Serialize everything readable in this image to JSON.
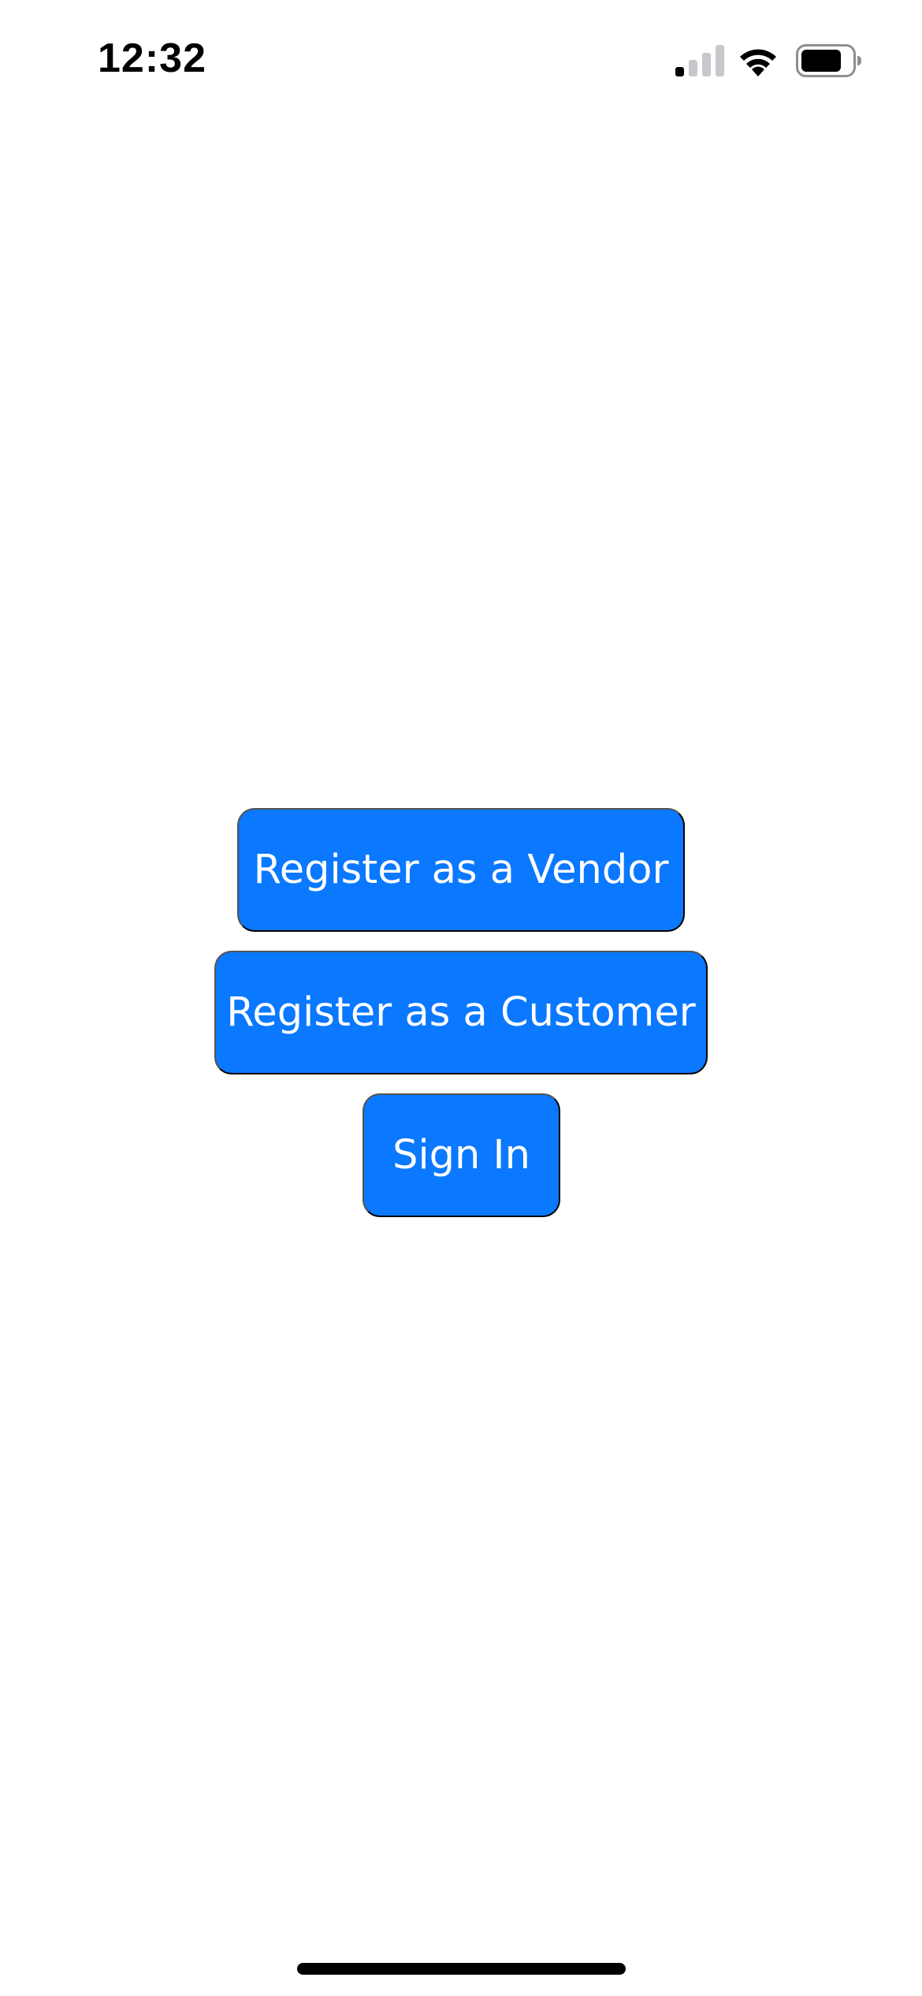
{
  "status_bar": {
    "time": "12:32",
    "signal_icon": "cellular-signal-icon",
    "wifi_icon": "wifi-icon",
    "battery_icon": "battery-icon",
    "signal_bars_active": 1,
    "signal_bars_total": 4,
    "battery_level": 0.8
  },
  "actions": {
    "register_vendor_label": "Register as a Vendor",
    "register_customer_label": "Register as a Customer",
    "sign_in_label": "Sign In"
  },
  "colors": {
    "button_background": "#0a78ff",
    "button_text": "#ffffff",
    "background": "#ffffff"
  }
}
